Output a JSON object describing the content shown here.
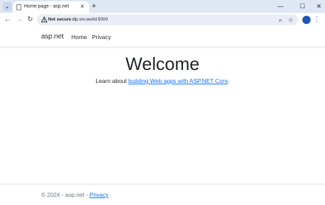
{
  "browser": {
    "tab": {
      "title": "Home page - asp.net"
    },
    "address_bar": {
      "security_label": "Not secure",
      "url": "dlp.srv.world:5000"
    },
    "icons": {
      "tab_dropdown": "chevron-down-icon",
      "favicon": "page-icon",
      "tab_close": "close-icon",
      "new_tab": "plus-icon",
      "minimize": "minimize-icon",
      "maximize": "maximize-icon",
      "close_window": "close-icon",
      "back": "back-arrow-icon",
      "forward": "forward-arrow-icon",
      "reload": "reload-icon",
      "warning": "warning-icon",
      "zoom": "zoom-icon",
      "bookmark": "star-icon",
      "profile": "profile-icon",
      "menu": "more-vert-icon"
    }
  },
  "site": {
    "brand": "asp.net",
    "nav": [
      {
        "label": "Home"
      },
      {
        "label": "Privacy"
      }
    ],
    "main": {
      "title": "Welcome",
      "lead_prefix": "Learn about ",
      "lead_link": "building Web apps with ASP.NET Core",
      "lead_suffix": "."
    },
    "footer": {
      "text": "© 2024 - asp.net - ",
      "privacy_link": "Privacy"
    }
  },
  "colors": {
    "tabstrip_bg": "#dfe7f5",
    "omnibox_bg": "#e9eef6",
    "link": "#0d6efd",
    "text": "#212529",
    "muted": "#6c757d"
  }
}
